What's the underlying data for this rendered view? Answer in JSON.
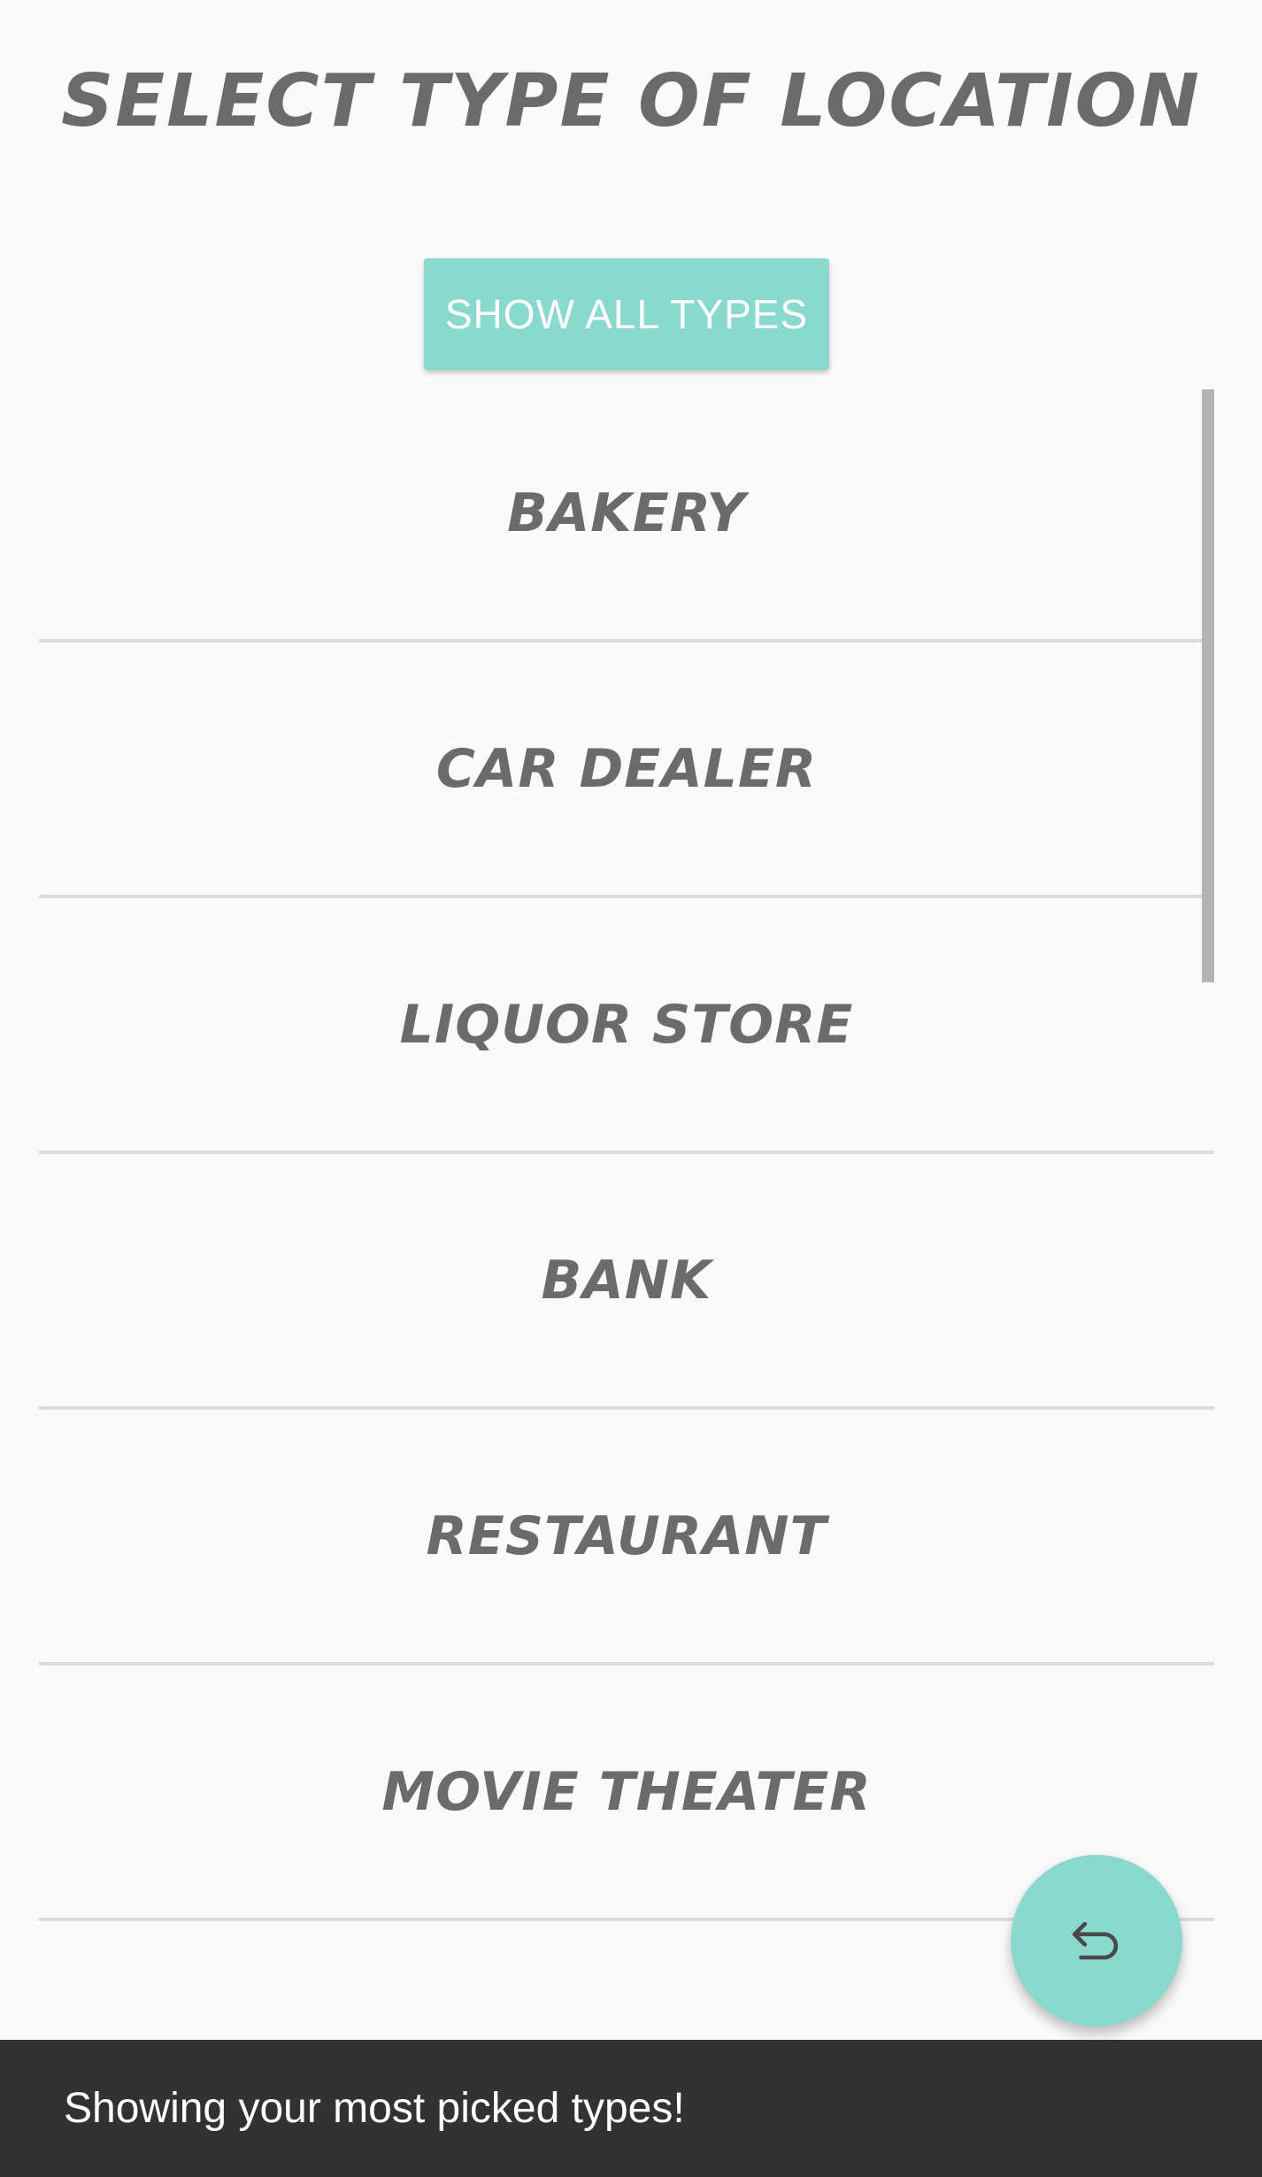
{
  "header": {
    "title": "SELECT TYPE OF LOCATION"
  },
  "actions": {
    "show_all_label": "SHOW ALL TYPES"
  },
  "location_types": [
    {
      "label": "BAKERY"
    },
    {
      "label": "CAR DEALER"
    },
    {
      "label": "LIQUOR STORE"
    },
    {
      "label": "BANK"
    },
    {
      "label": "RESTAURANT"
    },
    {
      "label": "MOVIE THEATER"
    }
  ],
  "fab": {
    "icon": "undo-icon"
  },
  "snackbar": {
    "message": "Showing your most picked types!"
  },
  "colors": {
    "accent": "#8ad9cf",
    "text": "#6b6b6b",
    "snackbar_bg": "#323232",
    "divider": "#dcdcdc",
    "background": "#fafafa"
  }
}
